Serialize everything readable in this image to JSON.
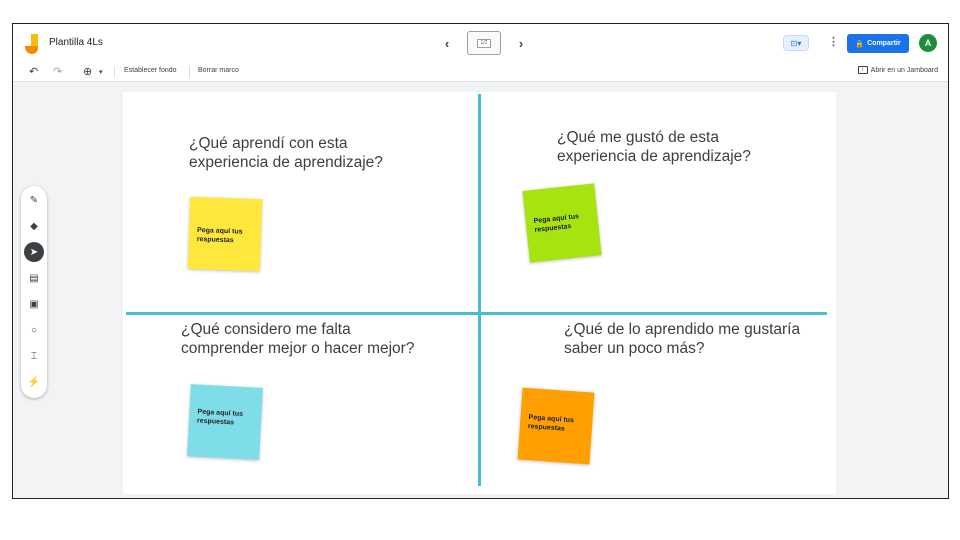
{
  "app": {
    "title": "Plantilla 4Ls",
    "frame_counter": "1/2",
    "share_label": "Compartir",
    "avatar_initial": "A",
    "accent_color": "#1a73e8"
  },
  "toolbar": {
    "set_background_label": "Establecer fondo",
    "clear_frame_label": "Borrar marco",
    "open_in_jamboard_label": "Abrir en un Jamboard"
  },
  "board": {
    "divider_color": "#47bed2",
    "quadrants": [
      {
        "question": "¿Qué aprendí con esta experiencia de aprendizaje?",
        "sticky_text": "Pega aquí tus respuestas",
        "sticky_color": "#ffe83b"
      },
      {
        "question": "¿Qué me gustó de esta experiencia de aprendizaje?",
        "sticky_text": "Pega aquí tus respuestas",
        "sticky_color": "#a6e30f"
      },
      {
        "question": "¿Qué considero me falta comprender mejor o hacer mejor?",
        "sticky_text": "Pega aquí tus respuestas",
        "sticky_color": "#7fdde9"
      },
      {
        "question": "¿Qué de lo aprendido me gustaría saber un poco más?",
        "sticky_text": "Pega aquí tus respuestas",
        "sticky_color": "#ffa000"
      }
    ]
  },
  "side_tools": [
    {
      "name": "pen-icon"
    },
    {
      "name": "eraser-icon"
    },
    {
      "name": "select-icon",
      "active": true
    },
    {
      "name": "sticky-note-icon"
    },
    {
      "name": "image-icon"
    },
    {
      "name": "circle-shape-icon"
    },
    {
      "name": "text-box-icon"
    },
    {
      "name": "laser-icon"
    }
  ]
}
